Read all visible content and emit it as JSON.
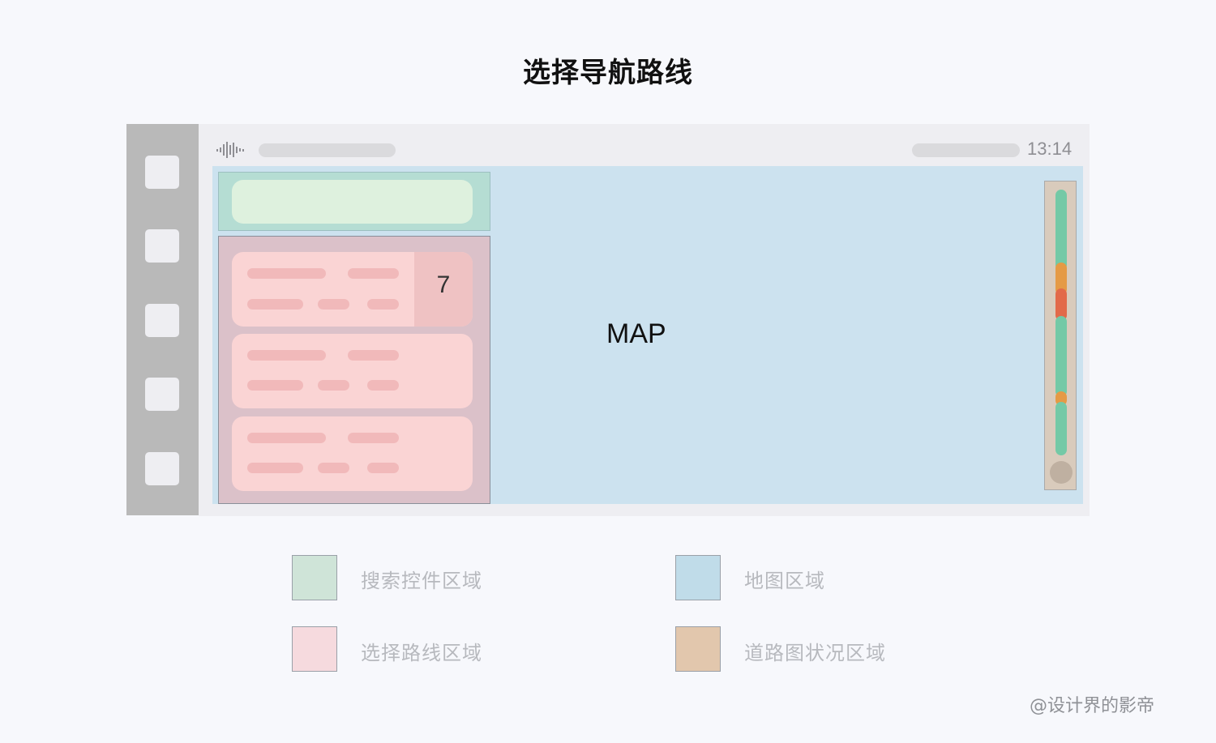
{
  "title": "选择导航路线",
  "screen": {
    "clock": "13:14",
    "map_label": "MAP",
    "route_cards": [
      {
        "badge": "7"
      },
      {
        "badge": ""
      },
      {
        "badge": ""
      }
    ],
    "traffic_segments": [
      "green",
      "orange",
      "red",
      "green",
      "orange",
      "green"
    ]
  },
  "colors": {
    "search_area": "#b5ddd3",
    "route_area": "#dbc1c9",
    "map_area": "#cce2ef",
    "traffic_area": "#d9cbbc",
    "traffic_green": "#74c9a6",
    "traffic_orange": "#e59a45",
    "traffic_red": "#e26a4a"
  },
  "legend": [
    {
      "label": "搜索控件区域",
      "color": "#cfe4d8"
    },
    {
      "label": "地图区域",
      "color": "#c0dce9"
    },
    {
      "label": "选择路线区域",
      "color": "#f6dade"
    },
    {
      "label": "道路图状况区域",
      "color": "#e2c7ad"
    }
  ],
  "credit": "@设计界的影帝"
}
